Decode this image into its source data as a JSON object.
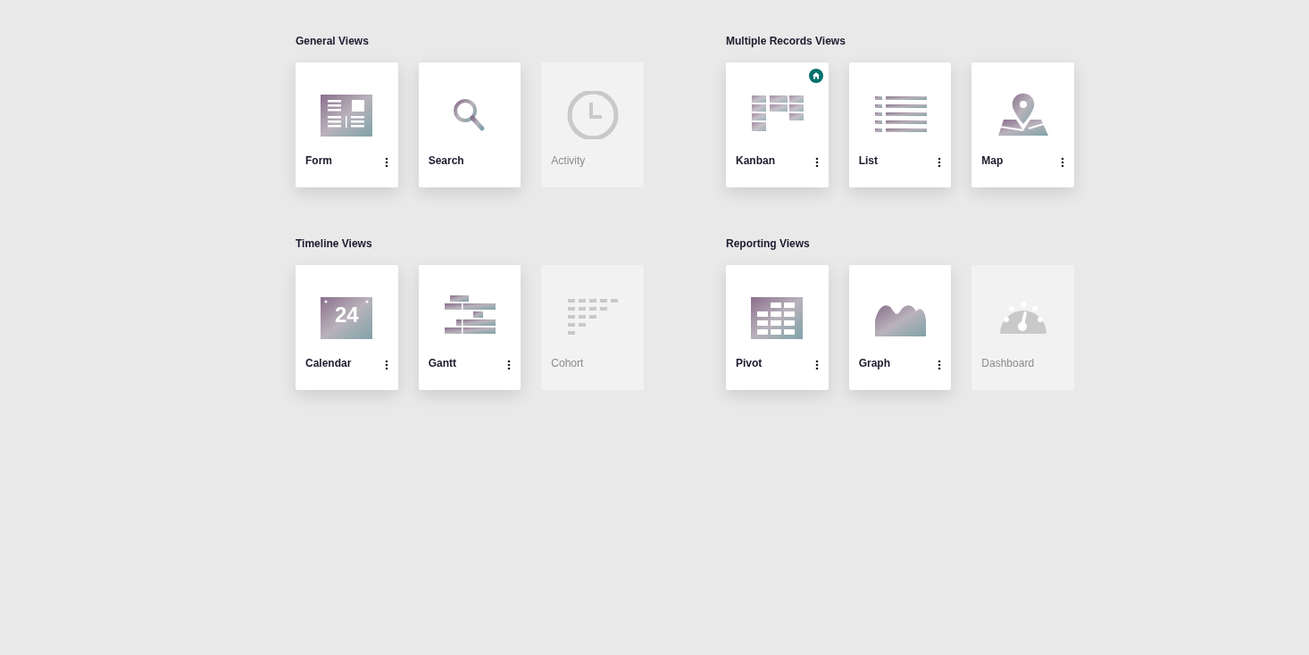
{
  "sections": [
    {
      "title": "General Views",
      "views": [
        {
          "label": "Form",
          "kind": "form",
          "enabled": true,
          "has_menu": true,
          "default": false
        },
        {
          "label": "Search",
          "kind": "search",
          "enabled": true,
          "has_menu": false,
          "default": false
        },
        {
          "label": "Activity",
          "kind": "activity",
          "enabled": false,
          "has_menu": false,
          "default": false
        }
      ]
    },
    {
      "title": "Multiple Records Views",
      "views": [
        {
          "label": "Kanban",
          "kind": "kanban",
          "enabled": true,
          "has_menu": true,
          "default": true
        },
        {
          "label": "List",
          "kind": "list",
          "enabled": true,
          "has_menu": true,
          "default": false
        },
        {
          "label": "Map",
          "kind": "map",
          "enabled": true,
          "has_menu": true,
          "default": false
        }
      ]
    },
    {
      "title": "Timeline Views",
      "views": [
        {
          "label": "Calendar",
          "kind": "calendar",
          "icon_text": "24",
          "enabled": true,
          "has_menu": true,
          "default": false
        },
        {
          "label": "Gantt",
          "kind": "gantt",
          "enabled": true,
          "has_menu": true,
          "default": false
        },
        {
          "label": "Cohort",
          "kind": "cohort",
          "enabled": false,
          "has_menu": false,
          "default": false
        }
      ]
    },
    {
      "title": "Reporting Views",
      "views": [
        {
          "label": "Pivot",
          "kind": "pivot",
          "enabled": true,
          "has_menu": true,
          "default": false
        },
        {
          "label": "Graph",
          "kind": "graph",
          "enabled": true,
          "has_menu": true,
          "default": false
        },
        {
          "label": "Dashboard",
          "kind": "dashboard",
          "enabled": false,
          "has_menu": false,
          "default": false
        }
      ]
    }
  ]
}
